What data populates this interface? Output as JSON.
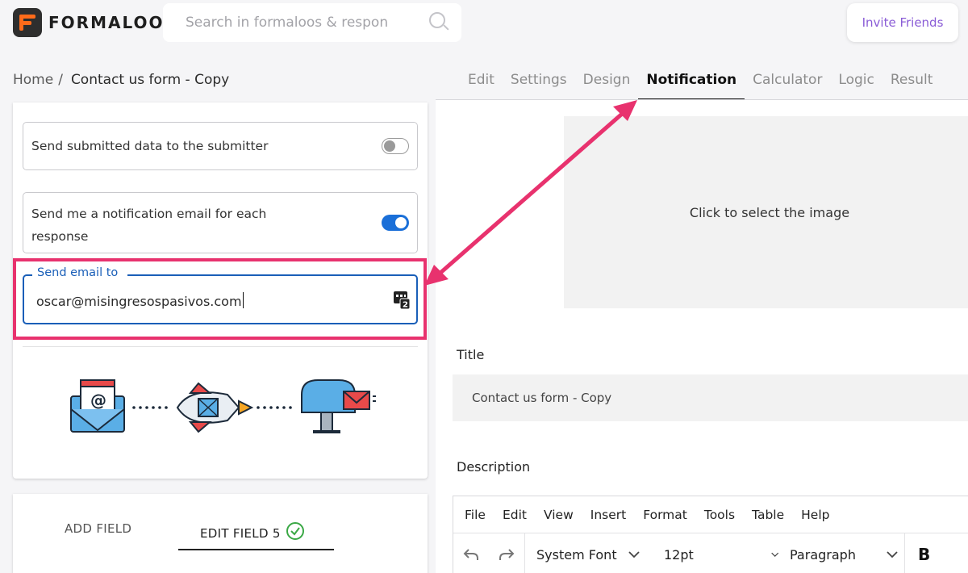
{
  "header": {
    "logo_text": "FORMALOO",
    "search_placeholder": "Search in formaloos & respon",
    "invite_label": "Invite Friends"
  },
  "breadcrumb": {
    "home": "Home",
    "separator": "/",
    "current": "Contact us form - Copy"
  },
  "tabs": [
    {
      "label": "Edit"
    },
    {
      "label": "Settings"
    },
    {
      "label": "Design"
    },
    {
      "label": "Notification",
      "active": true
    },
    {
      "label": "Calculator"
    },
    {
      "label": "Logic"
    },
    {
      "label": "Result"
    }
  ],
  "notification": {
    "send_submitter_label": "Send submitted data to the submitter",
    "send_submitter_on": false,
    "notify_me_label_line1": "Send me a notification email for each",
    "notify_me_label_line2": "response",
    "notify_me_on": true,
    "send_email_to_label": "Send email to",
    "send_email_to_value": "oscar@misingresospasivos.com"
  },
  "field_tabs": {
    "add_label": "ADD FIELD",
    "edit_label": "EDIT FIELD 5"
  },
  "right_panel": {
    "image_placeholder": "Click to select the image",
    "title_label": "Title",
    "title_value": "Contact us form - Copy",
    "description_label": "Description"
  },
  "editor": {
    "menu": [
      "File",
      "Edit",
      "View",
      "Insert",
      "Format",
      "Tools",
      "Table",
      "Help"
    ],
    "font": "System Font",
    "size": "12pt",
    "block": "Paragraph",
    "bold": "B"
  },
  "colors": {
    "accent": "#1a6fd8",
    "highlight": "#e8326e",
    "invite": "#8a5cd6",
    "brand": "#ff6b1a"
  }
}
